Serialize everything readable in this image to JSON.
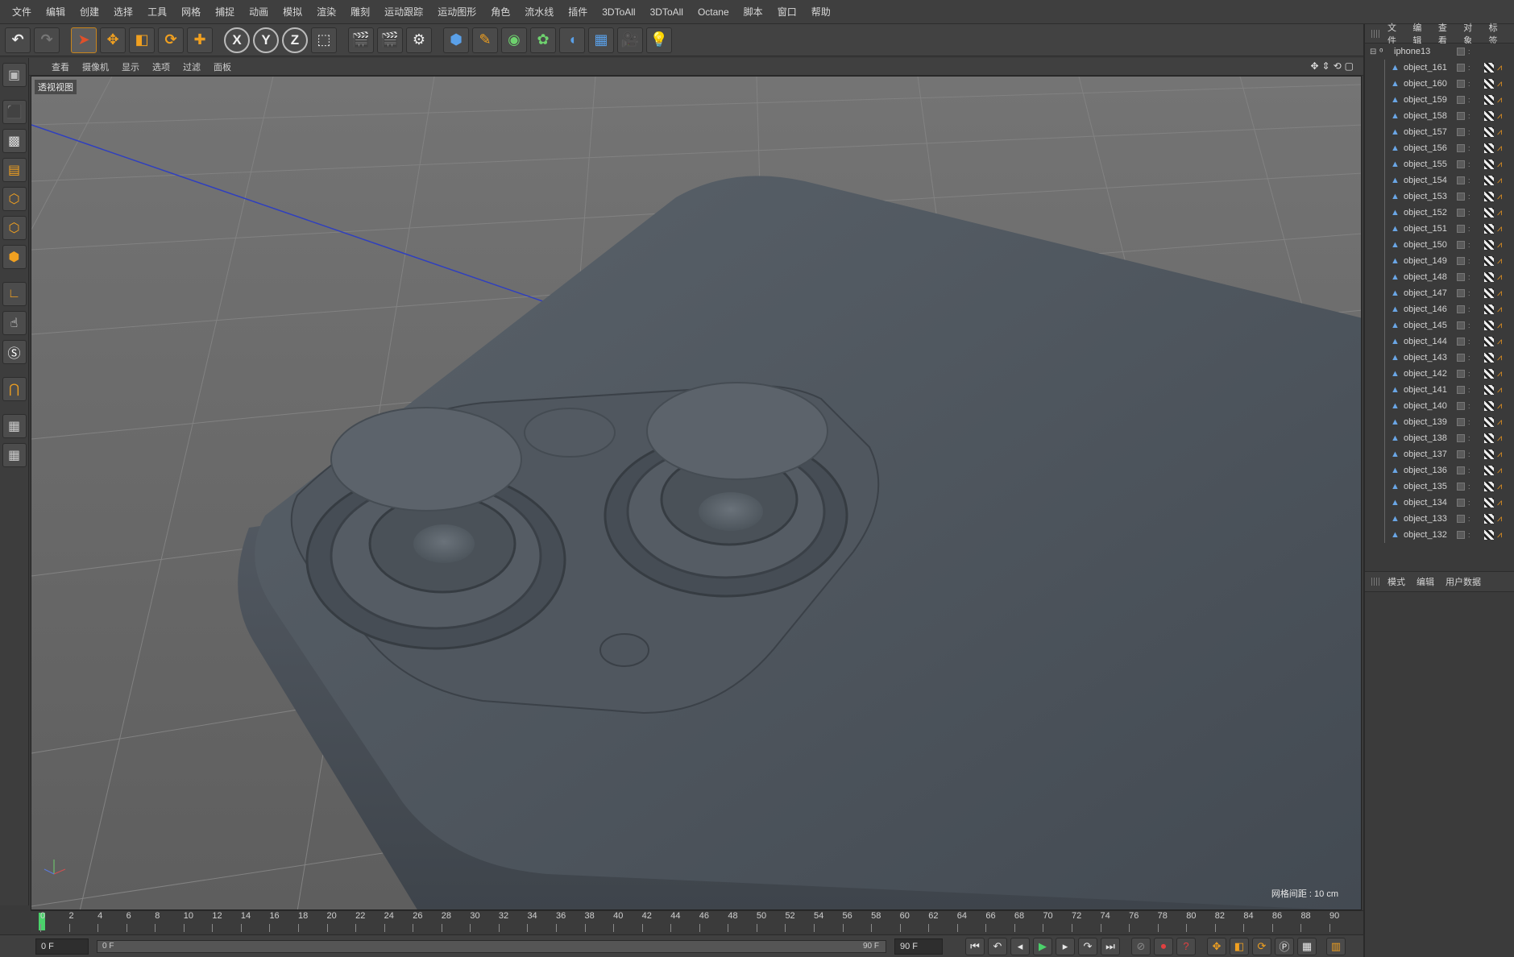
{
  "menubar": {
    "items": [
      "文件",
      "编辑",
      "创建",
      "选择",
      "工具",
      "网格",
      "捕捉",
      "动画",
      "模拟",
      "渲染",
      "雕刻",
      "运动跟踪",
      "运动图形",
      "角色",
      "流水线",
      "插件",
      "3DToAll",
      "3DToAll",
      "Octane",
      "脚本",
      "窗口",
      "帮助"
    ]
  },
  "toolbar": {
    "axis_x": "X",
    "axis_y": "Y",
    "axis_z": "Z"
  },
  "viewport": {
    "menu": [
      "查看",
      "摄像机",
      "显示",
      "选项",
      "过滤",
      "面板"
    ],
    "label": "透视视图",
    "grid_info": "网格间距 : 10 cm"
  },
  "timeline": {
    "ticks": [
      "0",
      "2",
      "4",
      "6",
      "8",
      "10",
      "12",
      "14",
      "16",
      "18",
      "20",
      "22",
      "24",
      "26",
      "28",
      "30",
      "32",
      "34",
      "36",
      "38",
      "40",
      "42",
      "44",
      "46",
      "48",
      "50",
      "52",
      "54",
      "56",
      "58",
      "60",
      "62",
      "64",
      "66",
      "68",
      "70",
      "72",
      "74",
      "76",
      "78",
      "80",
      "82",
      "84",
      "86",
      "88",
      "90"
    ],
    "current_frame": "0 F"
  },
  "transport": {
    "start_field": "0 F",
    "slider_start": "0 F",
    "slider_end": "90 F",
    "end_field": "90 F"
  },
  "object_manager": {
    "menu": [
      "文件",
      "编辑",
      "查看",
      "对象",
      "标签"
    ],
    "root": "iphone13",
    "objects": [
      "object_161",
      "object_160",
      "object_159",
      "object_158",
      "object_157",
      "object_156",
      "object_155",
      "object_154",
      "object_153",
      "object_152",
      "object_151",
      "object_150",
      "object_149",
      "object_148",
      "object_147",
      "object_146",
      "object_145",
      "object_144",
      "object_143",
      "object_142",
      "object_141",
      "object_140",
      "object_139",
      "object_138",
      "object_137",
      "object_136",
      "object_135",
      "object_134",
      "object_133",
      "object_132"
    ]
  },
  "attribute_manager": {
    "menu": [
      "模式",
      "编辑",
      "用户数据"
    ]
  },
  "colors": {
    "accent": "#f0a020",
    "playhead": "#4bd26b",
    "axis_line": "#2f3fbf"
  }
}
